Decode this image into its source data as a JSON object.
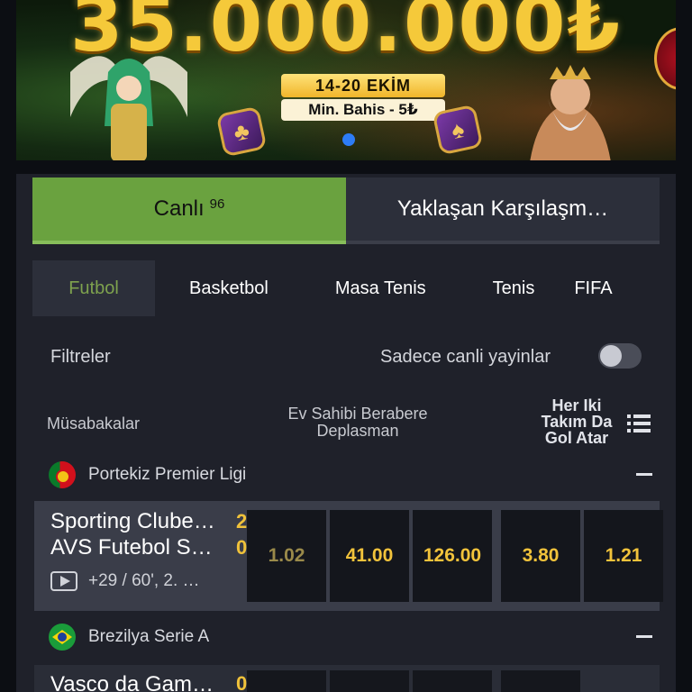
{
  "banner": {
    "amount": "35.000.000₺",
    "dates": "14-20 EKİM",
    "min_bet": "Min. Bahis - 5₺"
  },
  "main_tabs": {
    "live_label": "Canlı",
    "live_count": "96",
    "upcoming_label": "Yaklaşan Karşılaşm…"
  },
  "sports": [
    "Futbol",
    "Basketbol",
    "Masa Tenis",
    "Tenis",
    "FIFA"
  ],
  "filters": {
    "label": "Filtreler",
    "live_stream_only": "Sadece canli yayinlar"
  },
  "columns": {
    "matches": "Müsabakalar",
    "result_1x2": "Ev Sahibi Berabere Deplasman",
    "btts": "Her Iki Takım Da Gol Atar"
  },
  "leagues": [
    {
      "name": "Portekiz Premier Ligi",
      "match": {
        "home": "Sporting Clube…",
        "away": "AVS Futebol S…",
        "home_score": "2",
        "away_score": "0",
        "info": "+29 / 60', 2. …",
        "odds": [
          "1.02",
          "41.00",
          "126.00",
          "3.80",
          "1.21"
        ]
      }
    },
    {
      "name": "Brezilya Serie A",
      "match": {
        "home": "Vasco da Gam…",
        "home_score": "0"
      }
    }
  ]
}
